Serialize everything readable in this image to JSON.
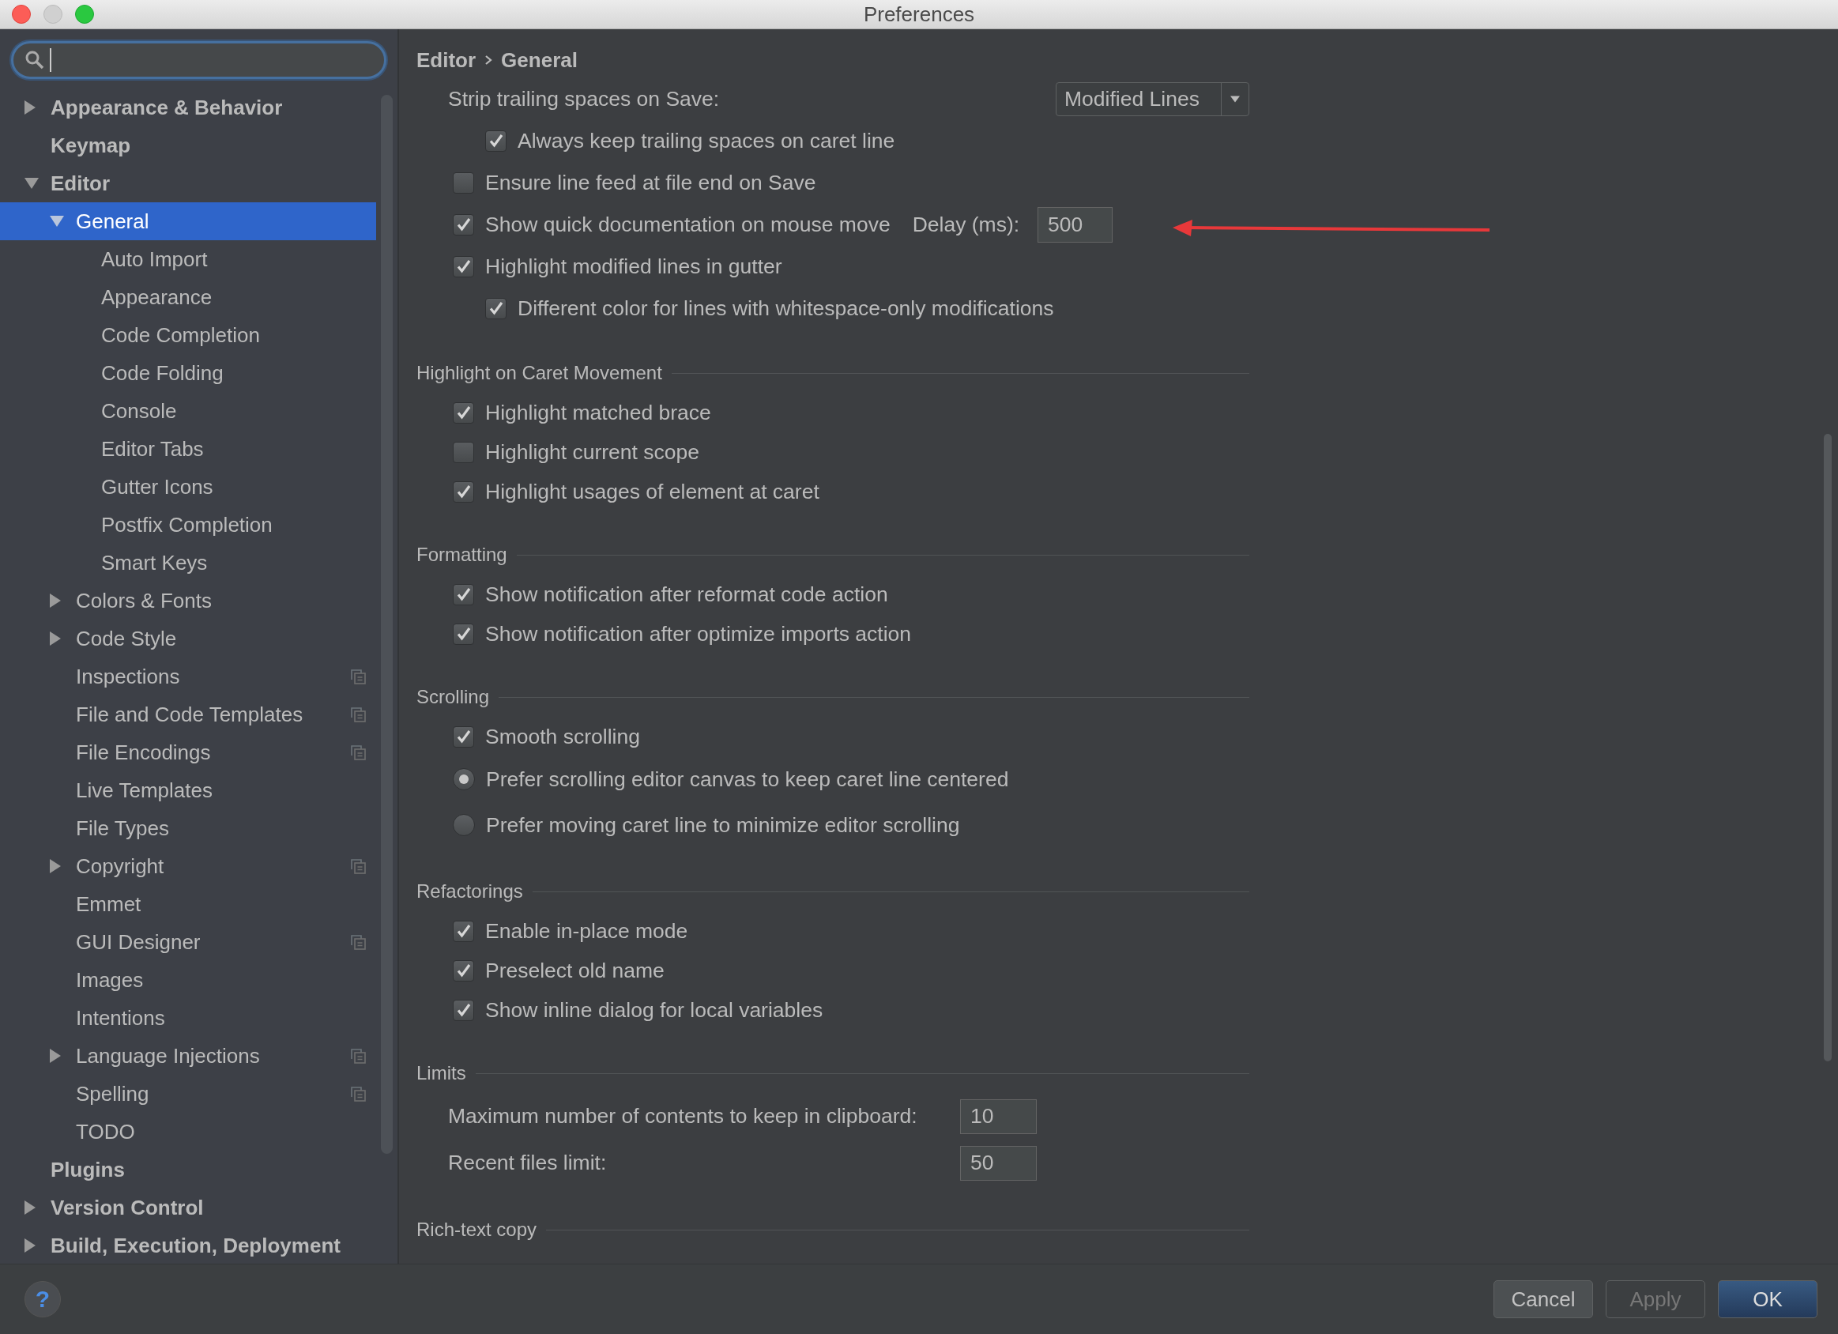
{
  "window": {
    "title": "Preferences"
  },
  "sidebar": {
    "items": [
      {
        "label": "Appearance & Behavior",
        "selected": false,
        "expanded": false
      },
      {
        "label": "Keymap",
        "selected": false
      },
      {
        "label": "Editor",
        "selected": false,
        "expanded": true,
        "children": [
          {
            "label": "General",
            "selected": true,
            "expanded": true,
            "children": [
              {
                "label": "Auto Import",
                "selected": false
              },
              {
                "label": "Appearance",
                "selected": false
              },
              {
                "label": "Code Completion",
                "selected": false
              },
              {
                "label": "Code Folding",
                "selected": false
              },
              {
                "label": "Console",
                "selected": false
              },
              {
                "label": "Editor Tabs",
                "selected": false
              },
              {
                "label": "Gutter Icons",
                "selected": false
              },
              {
                "label": "Postfix Completion",
                "selected": false
              },
              {
                "label": "Smart Keys",
                "selected": false
              }
            ]
          },
          {
            "label": "Colors & Fonts",
            "selected": false,
            "expanded": false
          },
          {
            "label": "Code Style",
            "selected": false,
            "expanded": false
          },
          {
            "label": "Inspections",
            "selected": false,
            "project_level": true
          },
          {
            "label": "File and Code Templates",
            "selected": false,
            "project_level": true
          },
          {
            "label": "File Encodings",
            "selected": false,
            "project_level": true
          },
          {
            "label": "Live Templates",
            "selected": false
          },
          {
            "label": "File Types",
            "selected": false
          },
          {
            "label": "Copyright",
            "selected": false,
            "expanded": false,
            "project_level": true
          },
          {
            "label": "Emmet",
            "selected": false
          },
          {
            "label": "GUI Designer",
            "selected": false,
            "project_level": true
          },
          {
            "label": "Images",
            "selected": false
          },
          {
            "label": "Intentions",
            "selected": false
          },
          {
            "label": "Language Injections",
            "selected": false,
            "expanded": false,
            "project_level": true
          },
          {
            "label": "Spelling",
            "selected": false,
            "project_level": true
          },
          {
            "label": "TODO",
            "selected": false
          }
        ]
      },
      {
        "label": "Plugins",
        "selected": false
      },
      {
        "label": "Version Control",
        "selected": false,
        "expanded": false
      },
      {
        "label": "Build, Execution, Deployment",
        "selected": false,
        "expanded": false
      }
    ]
  },
  "content": {
    "breadcrumb": [
      "Editor",
      "General"
    ],
    "sections": [
      {
        "items": [
          {
            "kind": "dropdown",
            "label": "Strip trailing spaces on Save:",
            "value": "Modified Lines",
            "children": [
              {
                "kind": "checkbox",
                "label": "Always keep trailing spaces on caret line",
                "checked": true
              }
            ]
          },
          {
            "kind": "checkbox",
            "label": "Ensure line feed at file end on Save",
            "checked": false
          },
          {
            "kind": "checkbox",
            "label": "Show quick documentation on mouse move",
            "checked": true,
            "field_label": "Delay (ms):",
            "value": "500"
          },
          {
            "kind": "checkbox",
            "label": "Highlight modified lines in gutter",
            "checked": true,
            "children": [
              {
                "kind": "checkbox",
                "label": "Different color for lines with whitespace-only modifications",
                "checked": true
              }
            ]
          }
        ]
      },
      {
        "title": "Highlight on Caret Movement",
        "items": [
          {
            "kind": "checkbox",
            "label": "Highlight matched brace",
            "checked": true
          },
          {
            "kind": "checkbox",
            "label": "Highlight current scope",
            "checked": false
          },
          {
            "kind": "checkbox",
            "label": "Highlight usages of element at caret",
            "checked": true
          }
        ]
      },
      {
        "title": "Formatting",
        "items": [
          {
            "kind": "checkbox",
            "label": "Show notification after reformat code action",
            "checked": true
          },
          {
            "kind": "checkbox",
            "label": "Show notification after optimize imports action",
            "checked": true
          }
        ]
      },
      {
        "title": "Scrolling",
        "items": [
          {
            "kind": "checkbox",
            "label": "Smooth scrolling",
            "checked": true
          },
          {
            "kind": "radio",
            "label": "Prefer scrolling editor canvas to keep caret line centered",
            "selected": true
          },
          {
            "kind": "radio",
            "label": "Prefer moving caret line to minimize editor scrolling",
            "selected": false
          }
        ]
      },
      {
        "title": "Refactorings",
        "items": [
          {
            "kind": "checkbox",
            "label": "Enable in-place mode",
            "checked": true
          },
          {
            "kind": "checkbox",
            "label": "Preselect old name",
            "checked": true
          },
          {
            "kind": "checkbox",
            "label": "Show inline dialog for local variables",
            "checked": true
          }
        ]
      },
      {
        "title": "Limits",
        "items": [
          {
            "kind": "number",
            "label": "Maximum number of contents to keep in clipboard:",
            "value": "10"
          },
          {
            "kind": "number",
            "label": "Recent files limit:",
            "value": "50"
          }
        ]
      },
      {
        "title": "Rich-text copy"
      }
    ],
    "annotations": [
      {
        "kind": "arrow"
      }
    ]
  },
  "help_button": "?",
  "buttons": [
    {
      "label": "Cancel",
      "disabled": false,
      "default": false
    },
    {
      "label": "Apply",
      "disabled": true,
      "default": false
    },
    {
      "label": "OK",
      "disabled": false,
      "default": true
    }
  ]
}
